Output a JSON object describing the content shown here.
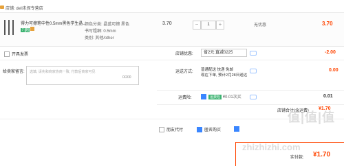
{
  "store": {
    "icon": "store-icon",
    "label": "店铺: dell未探专营店"
  },
  "item": {
    "title": "得力可擦笔中性0.5mm黑色学生晶...",
    "badges": [
      {
        "text": "7",
        "color": "#3cb371"
      },
      {
        "text": "险",
        "color": "#3cb371"
      },
      {
        "text": "",
        "color": "#e6a23c"
      }
    ],
    "specs": [
      "颜色分类: 晶蓝可擦 黑色",
      "书写粗细: 0.5mm",
      "类别: 其他/other"
    ],
    "price": "3.70",
    "quantity": "1",
    "minus": "−",
    "plus": "+",
    "discount": "无优惠",
    "subtotal": "3.70"
  },
  "invoice": {
    "label": "开具发票"
  },
  "store_coupon": {
    "label": "店铺优惠:",
    "selected": "省2元:直减0225",
    "amount": "-2.00"
  },
  "message": {
    "label": "给卖家留言:",
    "placeholder": "选填, 请先和商家协商一致, 付款后商家可见",
    "count": "0/200"
  },
  "shipping": {
    "label": "运送方式:",
    "line1": "普通配送 快递 免邮",
    "line2": "现在下单, 预计2月28日送达",
    "amount": "0.00"
  },
  "credit": {
    "label": "运费险:",
    "tag": "运费险",
    "text": "¥0.01次买",
    "amount": "0.01"
  },
  "grand_total": {
    "label": "店铺合计(含运费)",
    "value": "¥1.70"
  },
  "bottom": {
    "option1": "朋友代付",
    "option2": "匿名购买",
    "option3": "",
    "pay_label": "实付款:",
    "pay_value": "¥1.70"
  },
  "watermark": {
    "top": "值|值|值",
    "bottom": "zhizhizhi.com"
  },
  "colors": {
    "accent": "#ff4400",
    "blue": "#3a86ff",
    "green": "#3cb371"
  }
}
